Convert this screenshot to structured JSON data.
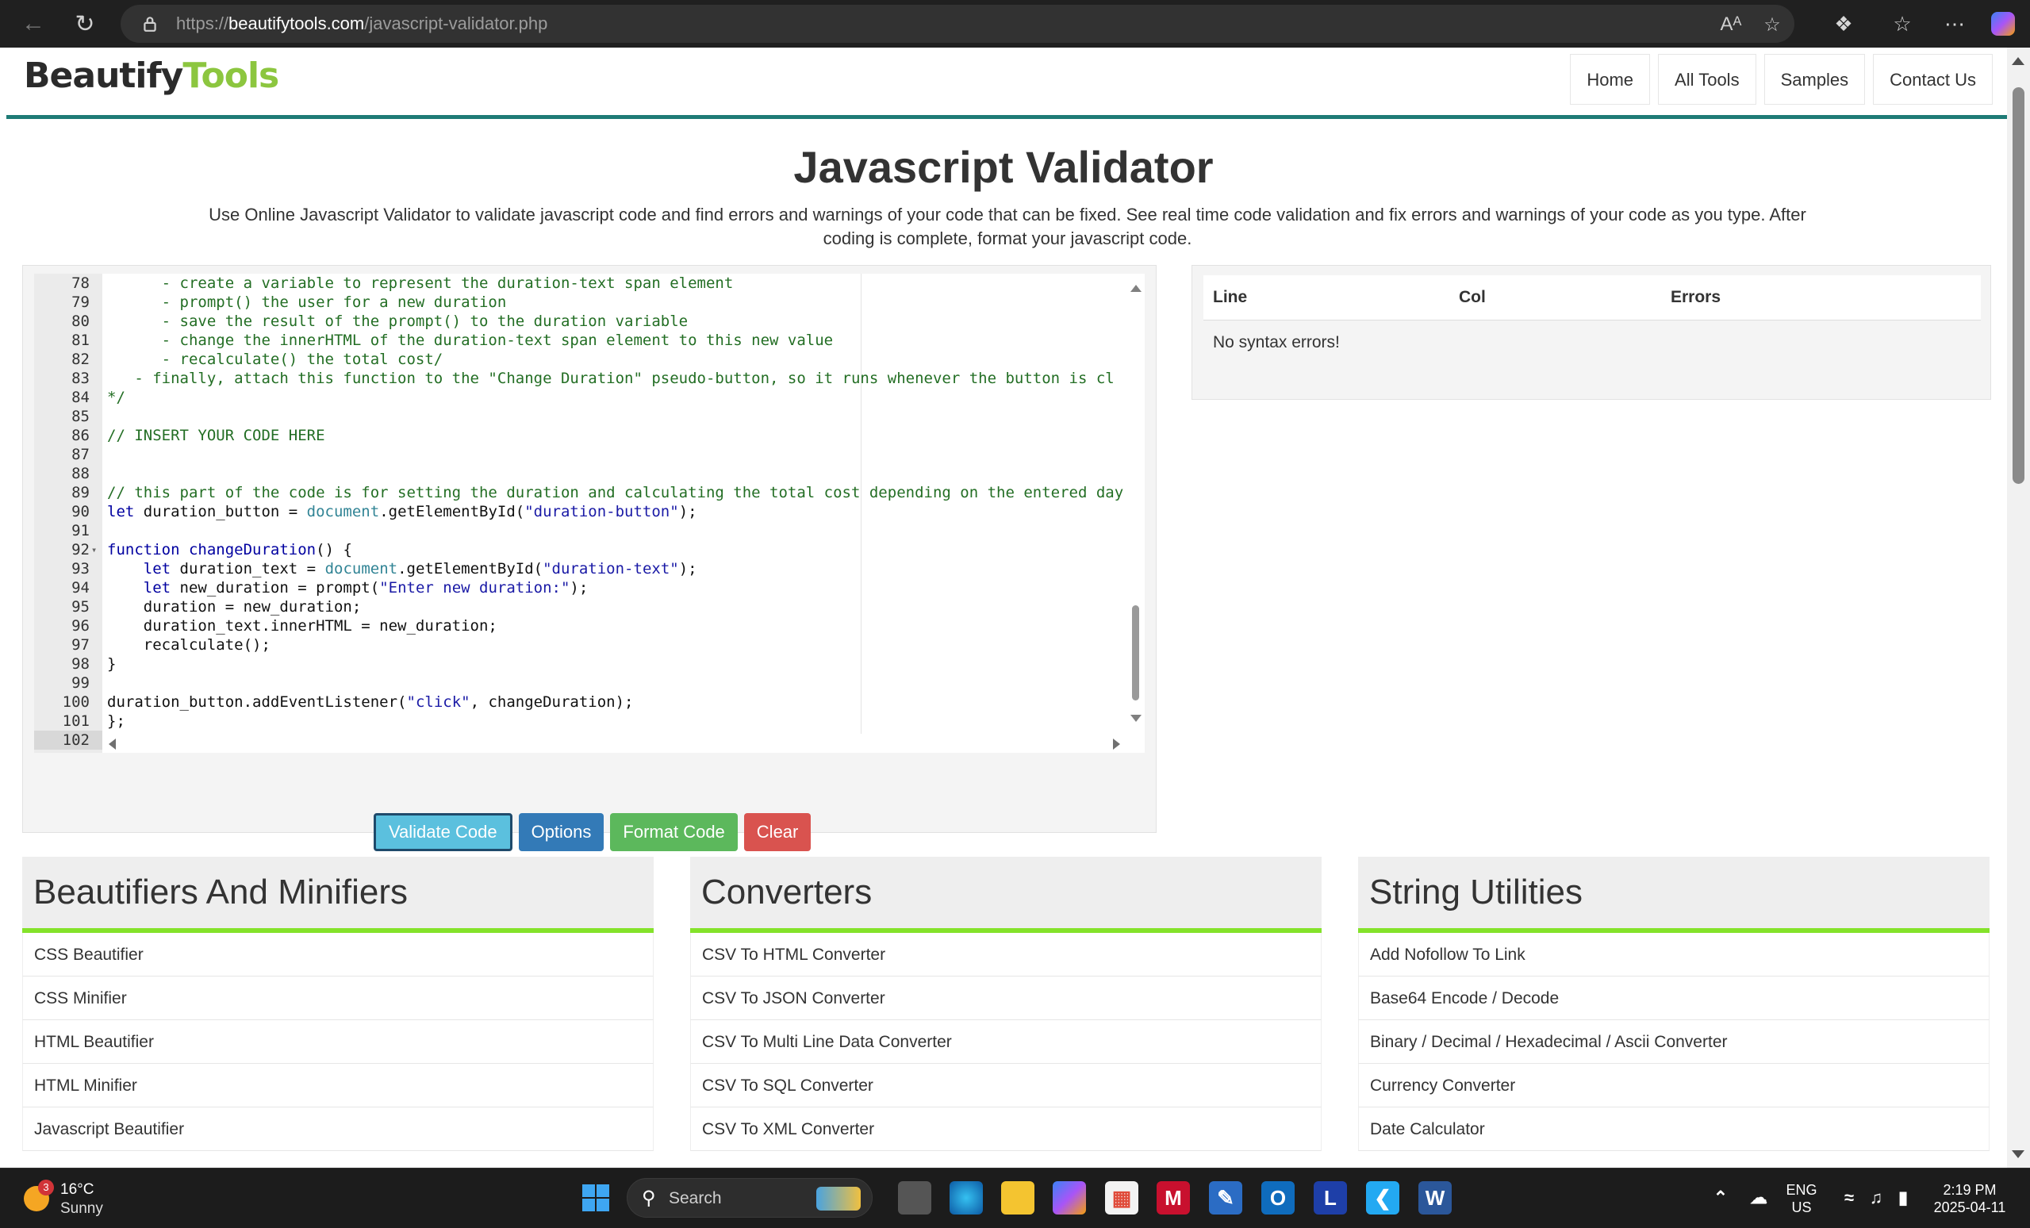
{
  "browser": {
    "url_prefix": "https://",
    "url_host": "beautifytools.com",
    "url_path": "/javascript-validator.php"
  },
  "site": {
    "logo_part1": "Beautify",
    "logo_part2": "Tools",
    "logo_accent": "#8cc63f",
    "nav": [
      "Home",
      "All Tools",
      "Samples",
      "Contact Us"
    ]
  },
  "page": {
    "title": "Javascript Validator",
    "description": "Use Online Javascript Validator to validate javascript code and find errors and warnings of your code that can be fixed. See real time code validation and fix errors and warnings of your code as you type. After coding is complete, format your javascript code."
  },
  "editor": {
    "active_line": "102",
    "lines": [
      {
        "n": "78",
        "t": "      - create a variable to represent the duration-text span element"
      },
      {
        "n": "79",
        "t": "      - prompt() the user for a new duration"
      },
      {
        "n": "80",
        "t": "      - save the result of the prompt() to the duration variable"
      },
      {
        "n": "81",
        "t": "      - change the innerHTML of the duration-text span element to this new value"
      },
      {
        "n": "82",
        "t": "      - recalculate() the total cost/"
      },
      {
        "n": "83",
        "t": "   - finally, attach this function to the \"Change Duration\" pseudo-button, so it runs whenever the button is cl"
      },
      {
        "n": "84",
        "t": "*/"
      },
      {
        "n": "85",
        "t": ""
      },
      {
        "n": "86",
        "t": "// INSERT YOUR CODE HERE"
      },
      {
        "n": "87",
        "t": ""
      },
      {
        "n": "88",
        "t": ""
      },
      {
        "n": "89",
        "t": "// this part of the code is for setting the duration and calculating the total cost depending on the entered day"
      },
      {
        "n": "90",
        "t": "let duration_button = document.getElementById(\"duration-button\");"
      },
      {
        "n": "91",
        "t": ""
      },
      {
        "n": "92",
        "t": "function changeDuration() {"
      },
      {
        "n": "93",
        "t": "    let duration_text = document.getElementById(\"duration-text\");"
      },
      {
        "n": "94",
        "t": "    let new_duration = prompt(\"Enter new duration:\");"
      },
      {
        "n": "95",
        "t": "    duration = new_duration;"
      },
      {
        "n": "96",
        "t": "    duration_text.innerHTML = new_duration;"
      },
      {
        "n": "97",
        "t": "    recalculate();"
      },
      {
        "n": "98",
        "t": "}"
      },
      {
        "n": "99",
        "t": ""
      },
      {
        "n": "100",
        "t": "duration_button.addEventListener(\"click\", changeDuration);"
      },
      {
        "n": "101",
        "t": "};"
      },
      {
        "n": "102",
        "t": ""
      }
    ]
  },
  "buttons": {
    "validate": "Validate Code",
    "options": "Options",
    "format": "Format Code",
    "clear": "Clear"
  },
  "results": {
    "col_line": "Line",
    "col_col": "Col",
    "col_errors": "Errors",
    "message": "No syntax errors!"
  },
  "categories": [
    {
      "title": "Beautifiers And Minifiers",
      "items": [
        "CSS Beautifier",
        "CSS Minifier",
        "HTML Beautifier",
        "HTML Minifier",
        "Javascript Beautifier"
      ]
    },
    {
      "title": "Converters",
      "items": [
        "CSV To HTML Converter",
        "CSV To JSON Converter",
        "CSV To Multi Line Data Converter",
        "CSV To SQL Converter",
        "CSV To XML Converter"
      ]
    },
    {
      "title": "String Utilities",
      "items": [
        "Add Nofollow To Link",
        "Base64 Encode / Decode",
        "Binary / Decimal / Hexadecimal / Ascii Converter",
        "Currency Converter",
        "Date Calculator"
      ]
    }
  ],
  "taskbar": {
    "weather_badge": "3",
    "temperature": "16°C",
    "condition": "Sunny",
    "search_label": "Search",
    "language_line1": "ENG",
    "language_line2": "US",
    "time": "2:19 PM",
    "date": "2025-04-11"
  }
}
